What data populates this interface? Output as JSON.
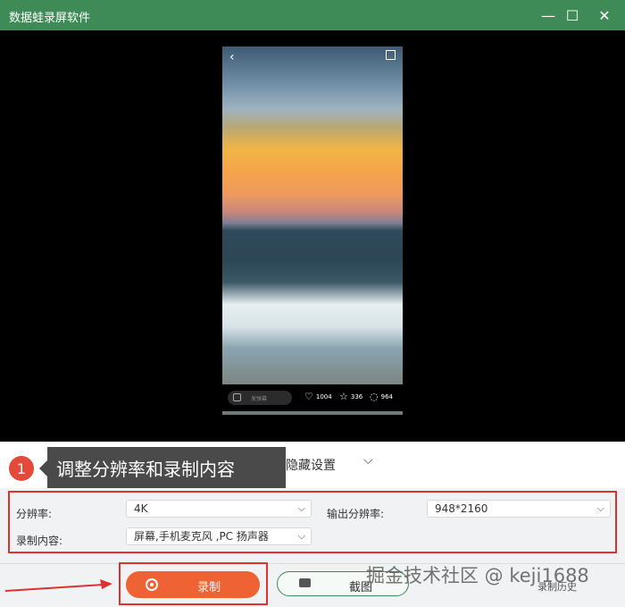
{
  "window": {
    "title": "数据蛙录屏软件",
    "minimize": "—",
    "maximize": "☐",
    "close": "✕"
  },
  "preview": {
    "back": "‹",
    "plus": "+",
    "comment_placeholder": "发弹幕",
    "likes": "1004",
    "stars": "336",
    "comments": "964"
  },
  "section": {
    "label": "隐藏设置",
    "chevron": "⌵"
  },
  "callout": {
    "number": "1",
    "text": "调整分辨率和录制内容"
  },
  "settings": {
    "resolution_label": "分辨率:",
    "resolution_value": "4K",
    "output_label": "输出分辨率:",
    "output_value": "948*2160",
    "content_label": "录制内容:",
    "content_value": "屏幕,手机麦克风 ,PC 扬声器",
    "dropdown": "⌵"
  },
  "actions": {
    "record": "录制",
    "snapshot": "截图",
    "history": "录制历史"
  },
  "watermark": "掘金技术社区 @ keji1688",
  "colors": {
    "titlebar": "#3f8b57",
    "record": "#ef6234",
    "highlight": "#e03131"
  }
}
